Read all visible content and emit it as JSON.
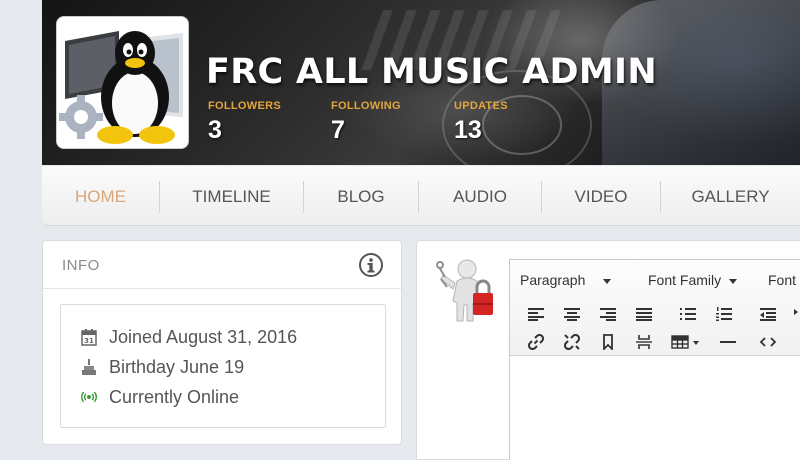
{
  "profile": {
    "name": "FRC ALL MUSIC ADMIN",
    "stats": [
      {
        "label": "FOLLOWERS",
        "value": "3"
      },
      {
        "label": "FOLLOWING",
        "value": "7"
      },
      {
        "label": "UPDATES",
        "value": "13"
      }
    ]
  },
  "nav": {
    "items": [
      {
        "label": "HOME",
        "active": true
      },
      {
        "label": "TIMELINE"
      },
      {
        "label": "BLOG"
      },
      {
        "label": "AUDIO"
      },
      {
        "label": "VIDEO"
      },
      {
        "label": "GALLERY"
      }
    ]
  },
  "info": {
    "title": "INFO",
    "rows": [
      {
        "icon": "calendar-icon",
        "text": "Joined August 31, 2016"
      },
      {
        "icon": "cake-icon",
        "text": "Birthday June 19"
      },
      {
        "icon": "online-signal-icon",
        "text": "Currently Online"
      }
    ]
  },
  "editor": {
    "format_select": "Paragraph",
    "font_family_select": "Font Family",
    "font_size_select": "Font"
  },
  "colors": {
    "accent": "#e3a63c",
    "nav_active": "#d9a57a",
    "online": "#3a9a3a"
  }
}
